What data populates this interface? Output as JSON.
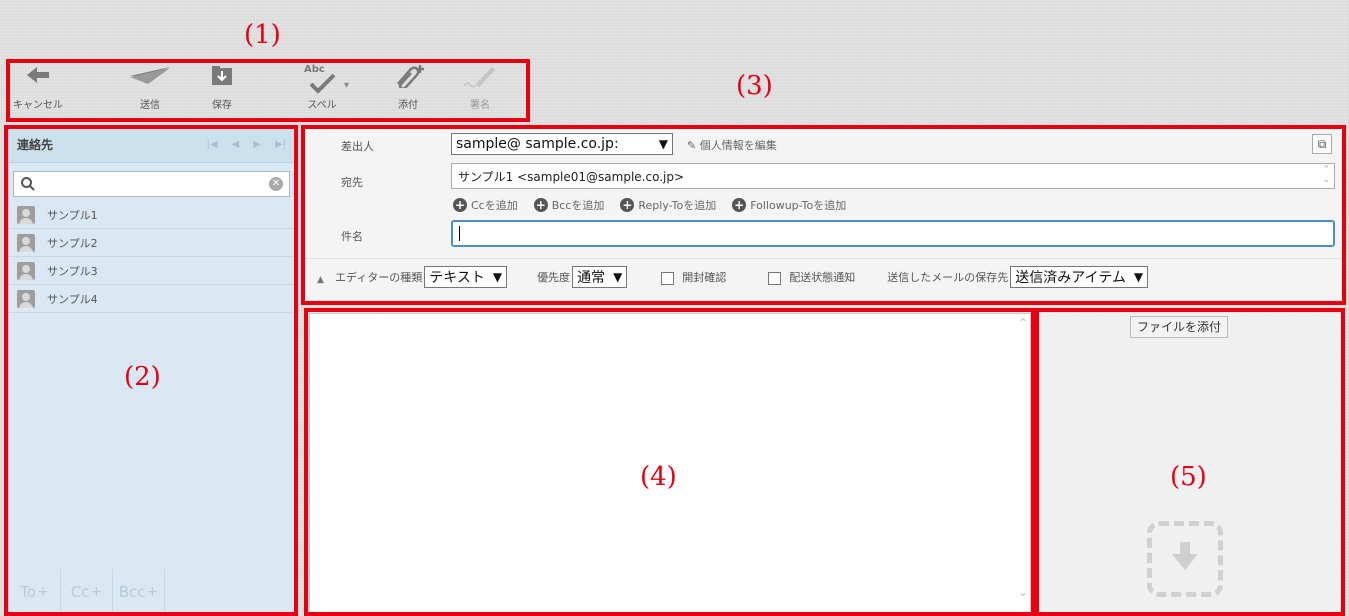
{
  "callouts": [
    "(1)",
    "(2)",
    "(3)",
    "(4)",
    "(5)"
  ],
  "toolbar": {
    "cancel": "キャンセル",
    "send": "送信",
    "save": "保存",
    "spell": "スペル",
    "spell_icon_text": "Abc",
    "attach": "添付",
    "signature": "署名"
  },
  "contacts": {
    "title": "連絡先",
    "search_placeholder": "",
    "items": [
      "サンプル1",
      "サンプル2",
      "サンプル3",
      "サンプル4"
    ],
    "bottom": [
      "To",
      "Cc",
      "Bcc"
    ]
  },
  "compose": {
    "from_label": "差出人",
    "from_value": "sample@ sample.co.jp:",
    "edit_profile": "個人情報を編集",
    "to_label": "宛先",
    "to_value": "サンプル1 <sample01@sample.co.jp>",
    "add_cc": "Ccを追加",
    "add_bcc": "Bccを追加",
    "add_reply_to": "Reply-Toを追加",
    "add_followup_to": "Followup-Toを追加",
    "subject_label": "件名",
    "subject_value": "",
    "editor_type_label": "エディターの種類",
    "editor_type_value": "テキスト",
    "priority_label": "優先度",
    "priority_value": "通常",
    "read_receipt": "開封確認",
    "delivery_status": "配送状態通知",
    "save_sent_label": "送信したメールの保存先",
    "save_sent_value": "送信済みアイテム"
  },
  "attachments": {
    "attach_button": "ファイルを添付"
  },
  "colors": {
    "annotation_red": "#e60012",
    "contacts_bg": "#d9e8f3",
    "subject_focus": "#4a90c8"
  }
}
